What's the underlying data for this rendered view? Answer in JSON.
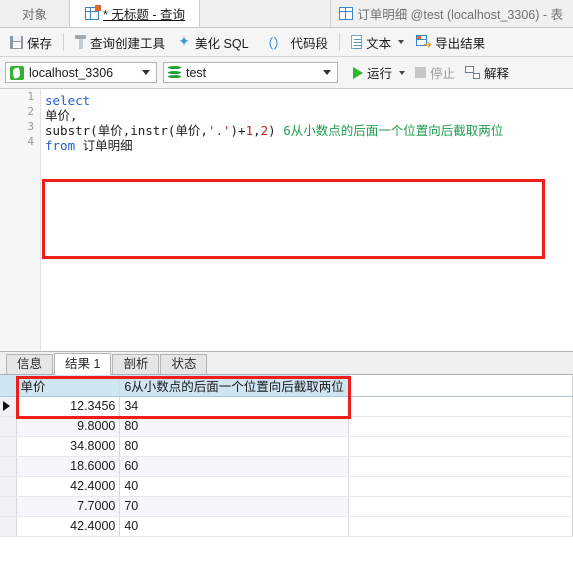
{
  "tabbar": {
    "object_tab": "对象",
    "query_tab": "* 无标题 - 查询",
    "table_tab": "订单明细 @test (localhost_3306) - 表"
  },
  "toolbar": {
    "save": "保存",
    "query_builder": "查询创建工具",
    "beautify_sql": "美化 SQL",
    "code_snippet": "代码段",
    "text": "文本",
    "export_result": "导出结果"
  },
  "connbar": {
    "connection": "localhost_3306",
    "database": "test",
    "run": "运行",
    "stop": "停止",
    "explain": "解释"
  },
  "editor": {
    "line_numbers": [
      "1",
      "2",
      "3",
      "4"
    ],
    "lines": [
      {
        "tokens": [
          {
            "t": "select",
            "c": "kw"
          }
        ]
      },
      {
        "tokens": [
          {
            "t": "单价,",
            "c": "plain"
          }
        ]
      },
      {
        "tokens": [
          {
            "t": "substr(",
            "c": "plain"
          },
          {
            "t": "单价",
            "c": "plain"
          },
          {
            "t": ",instr(",
            "c": "plain"
          },
          {
            "t": "单价",
            "c": "plain"
          },
          {
            "t": ",",
            "c": "plain"
          },
          {
            "t": "'.'",
            "c": "str"
          },
          {
            "t": ")+",
            "c": "plain"
          },
          {
            "t": "1",
            "c": "num"
          },
          {
            "t": ",",
            "c": "plain"
          },
          {
            "t": "2",
            "c": "num"
          },
          {
            "t": ") ",
            "c": "plain"
          },
          {
            "t": "6从小数点的后面一个位置向后截取两位",
            "c": "cmt"
          }
        ]
      },
      {
        "tokens": [
          {
            "t": "from",
            "c": "kw"
          },
          {
            "t": " 订单明细",
            "c": "plain"
          }
        ]
      }
    ]
  },
  "result_tabs": [
    {
      "label": "信息",
      "active": false
    },
    {
      "label": "结果 1",
      "active": true
    },
    {
      "label": "剖析",
      "active": false
    },
    {
      "label": "状态",
      "active": false
    }
  ],
  "grid": {
    "columns": [
      "单价",
      "6从小数点的后面一个位置向后截取两位"
    ],
    "rows": [
      {
        "price": "12.3456",
        "expr": "34"
      },
      {
        "price": "9.8000",
        "expr": "80"
      },
      {
        "price": "34.8000",
        "expr": "80"
      },
      {
        "price": "18.6000",
        "expr": "60"
      },
      {
        "price": "42.4000",
        "expr": "40"
      },
      {
        "price": "7.7000",
        "expr": "70"
      },
      {
        "price": "42.4000",
        "expr": "40"
      }
    ],
    "selected_row_index": 0
  },
  "colors": {
    "highlight_box": "#f01d1d",
    "header_bg": "#cfe5f2",
    "run_green": "#2db92d",
    "comment_green": "#1f9b4d",
    "keyword_blue": "#1f5fd0",
    "string_red": "#c21f1f"
  }
}
